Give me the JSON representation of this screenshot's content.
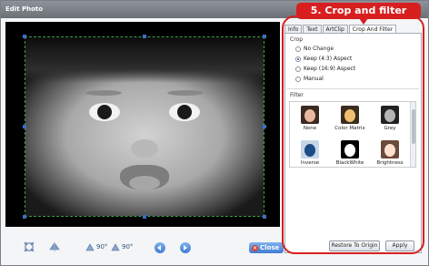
{
  "window": {
    "title": "Edit Photo"
  },
  "callout": {
    "text": "5. Crop and filter"
  },
  "tabs": [
    {
      "label": "Info",
      "active": false
    },
    {
      "label": "Text",
      "active": false
    },
    {
      "label": "ArtClip",
      "active": false
    },
    {
      "label": "Crop And Filter",
      "active": true
    }
  ],
  "crop": {
    "title": "Crop",
    "options": [
      {
        "label": "No Change",
        "selected": false
      },
      {
        "label": "Keep (4:3) Aspect",
        "selected": true
      },
      {
        "label": "Keep (16:9) Aspect",
        "selected": false
      },
      {
        "label": "Manual",
        "selected": false
      }
    ]
  },
  "filter": {
    "title": "Filter",
    "items": [
      {
        "label": "None",
        "icon": "filter-none-thumb"
      },
      {
        "label": "Color Matrix",
        "icon": "filter-color-matrix-thumb"
      },
      {
        "label": "Grey",
        "icon": "filter-grey-thumb"
      },
      {
        "label": "Inverse",
        "icon": "filter-inverse-thumb"
      },
      {
        "label": "BlackWhite",
        "icon": "filter-blackwhite-thumb"
      },
      {
        "label": "Brightness",
        "icon": "filter-brightness-thumb"
      }
    ]
  },
  "buttons": {
    "restore": "Restore To Origin",
    "apply": "Apply",
    "close": "Close"
  },
  "toolbar": {
    "rotate_left_label": "90°",
    "rotate_right_label": "90°"
  },
  "colors": {
    "accent_red": "#d81f1f",
    "button_blue": "#3f7bd1",
    "crop_border": "#3ea34a"
  }
}
